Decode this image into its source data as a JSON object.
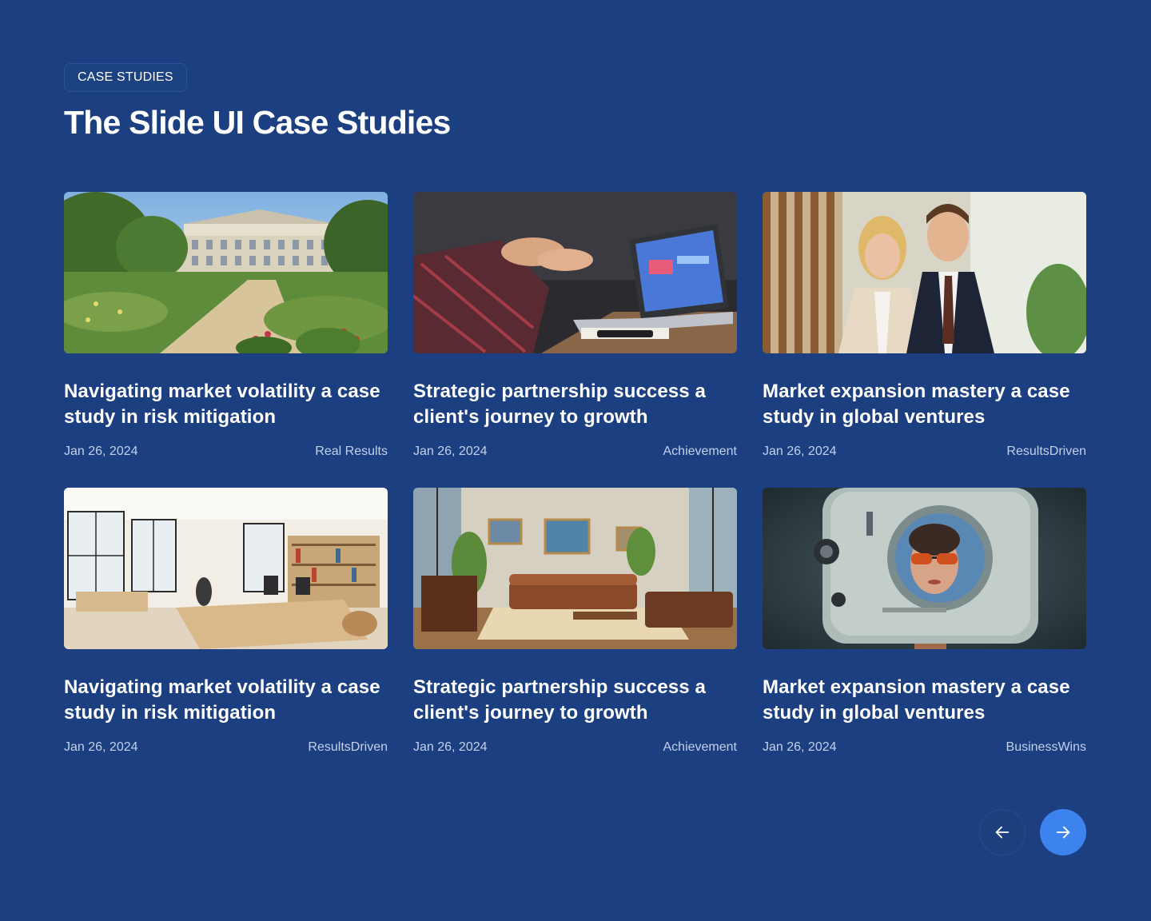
{
  "section": {
    "badge": "CASE STUDIES",
    "title": "The Slide UI Case Studies"
  },
  "cards": [
    {
      "title": "Navigating market volatility a case study in risk mitigation",
      "date": "Jan 26, 2024",
      "tag": "Real Results",
      "image": "garden-mansion-image"
    },
    {
      "title": "Strategic partnership success a client's journey to growth",
      "date": "Jan 26, 2024",
      "tag": "Achievement",
      "image": "meeting-laptop-image"
    },
    {
      "title": "Market expansion mastery a case study in global ventures",
      "date": "Jan 26, 2024",
      "tag": "ResultsDriven",
      "image": "business-people-image"
    },
    {
      "title": "Navigating market volatility a case study in risk mitigation",
      "date": "Jan 26, 2024",
      "tag": "ResultsDriven",
      "image": "bright-office-image"
    },
    {
      "title": "Strategic partnership success a client's journey to growth",
      "date": "Jan 26, 2024",
      "tag": "Achievement",
      "image": "lounge-interior-image"
    },
    {
      "title": "Market expansion mastery a case study in global ventures",
      "date": "Jan 26, 2024",
      "tag": "BusinessWins",
      "image": "retro-robot-image"
    }
  ],
  "nav": {
    "prev_icon": "arrow-left-icon",
    "next_icon": "arrow-right-icon"
  },
  "colors": {
    "background": "#1b3f80",
    "accent": "#3d83ee",
    "meta_text": "#c3d1ea"
  }
}
